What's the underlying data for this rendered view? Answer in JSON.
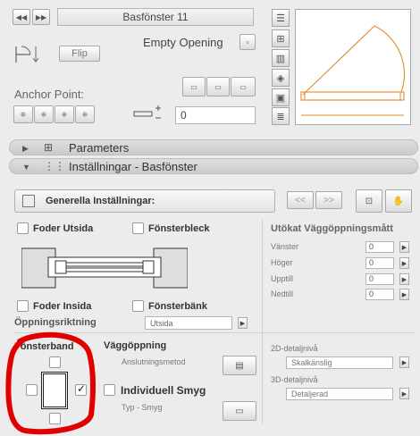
{
  "header": {
    "prev_label": "◀◀",
    "next_label": "▶▶",
    "title": "Basfönster 11",
    "flip_label": "Flip",
    "empty_opening_label": "Empty Opening",
    "anchor_point_label": "Anchor Point:",
    "offset_value": "0"
  },
  "sections": {
    "parameters_label": "Parameters",
    "settings_label": "Inställningar - Basfönster"
  },
  "settings": {
    "page_select": "Generella Inställningar:",
    "prev_page": "<<",
    "next_page": ">>"
  },
  "frame": {
    "foder_utsida": "Foder Utsida",
    "fonsterbleck": "Fönsterbleck",
    "foder_insida": "Foder Insida",
    "fonsterbank": "Fönsterbänk",
    "oppningsriktning_label": "Öppningsriktning",
    "oppningsriktning_value": "Utsida"
  },
  "utokat": {
    "title": "Utökat Väggöppningsmått",
    "rows": [
      {
        "label": "Vänster",
        "value": "0"
      },
      {
        "label": "Höger",
        "value": "0"
      },
      {
        "label": "Upptill",
        "value": "0"
      },
      {
        "label": "Nedtill",
        "value": "0"
      }
    ]
  },
  "bottom": {
    "fonsterband_label": "Fönsterband",
    "vaggoppning_label": "Väggöppning",
    "anslutningsmetod_label": "Anslutningsmetod",
    "individuell_smyg_label": "Individuell Smyg",
    "typ_smyg_label": "Typ - Smyg",
    "detalj2d_label": "2D-detaljnivå",
    "detalj2d_value": "Skalkänslig",
    "detalj3d_label": "3D-detaljnivå",
    "detalj3d_value": "Detaljerad"
  },
  "colors": {
    "preview_line": "#e08a2a",
    "highlight": "#e00000"
  }
}
